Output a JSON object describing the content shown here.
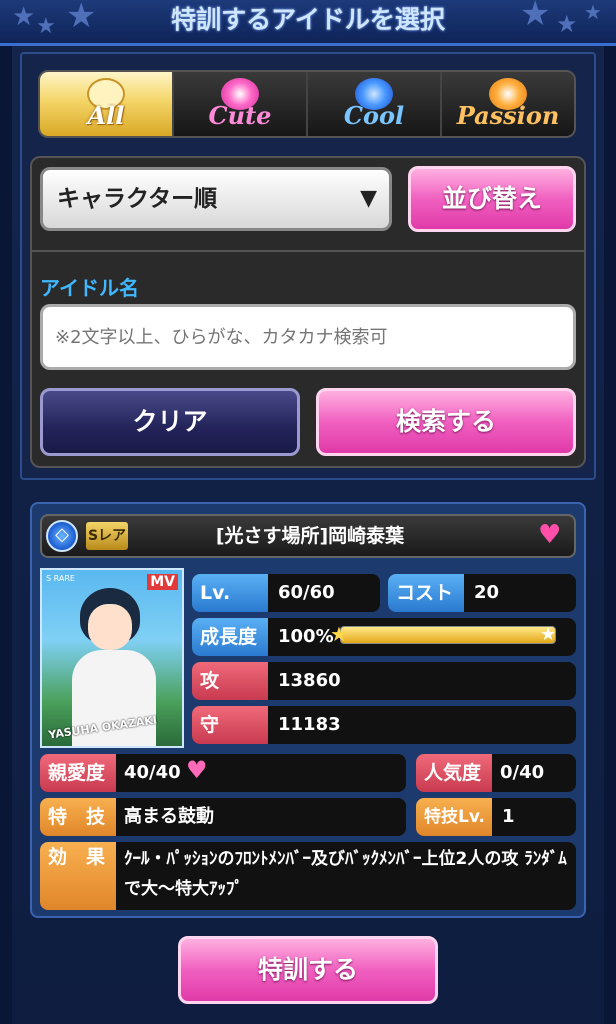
{
  "header": {
    "title": "特訓するアイドルを選択"
  },
  "tabs": [
    {
      "label": "All",
      "active": true,
      "color": "#ffffff"
    },
    {
      "label": "Cute",
      "active": false,
      "color": "#ff7ad0"
    },
    {
      "label": "Cool",
      "active": false,
      "color": "#5ab8ff"
    },
    {
      "label": "Passion",
      "active": false,
      "color": "#ffb040"
    }
  ],
  "sort": {
    "selected": "キャラクター順",
    "button_label": "並び替え"
  },
  "search": {
    "label": "アイドル名",
    "placeholder": "※2文字以上、ひらがな、カタカナ検索可",
    "clear_label": "クリア",
    "submit_label": "検索する"
  },
  "card": {
    "type_icon": "cool-gem-icon",
    "rarity": "Sレア",
    "name": "[光さす場所]岡崎泰葉",
    "favorite": true,
    "image_caption": "YASUHA OKAZAKI",
    "image_badge": "MV",
    "image_rarity": "S RARE",
    "level_label": "Lv.",
    "level_value": "60/60",
    "cost_label": "コスト",
    "cost_value": "20",
    "growth_label": "成長度",
    "growth_value": "100%",
    "growth_percent": 100,
    "attack_label": "攻",
    "attack_value": "13860",
    "defense_label": "守",
    "defense_value": "11183",
    "affection_label": "親愛度",
    "affection_value": "40/40",
    "popularity_label": "人気度",
    "popularity_value": "0/40",
    "skill_label": "特　技",
    "skill_value": "高まる鼓動",
    "skill_level_label": "特技Lv.",
    "skill_level_value": "1",
    "effect_label": "効　果",
    "effect_value": "ｸｰﾙ・ﾊﾟｯｼｮﾝのﾌﾛﾝﾄﾒﾝﾊﾞｰ及びﾊﾞｯｸﾒﾝﾊﾞｰ上位2人の攻 ﾗﾝﾀﾞﾑで大〜特大ｱｯﾌﾟ"
  },
  "action": {
    "train_label": "特訓する"
  }
}
